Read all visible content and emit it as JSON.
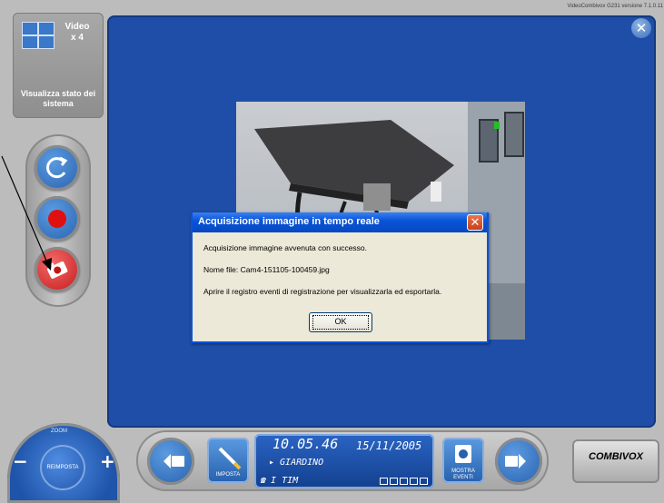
{
  "app": {
    "version_text": "VideoCombivox G231 versione 7.1.0.11"
  },
  "sidebar": {
    "video_label": "Video",
    "video_count": "x 4",
    "status_label": "Visualizza stato dei sistema"
  },
  "dialog": {
    "title": "Acquisizione immagine in tempo reale",
    "message": "Acquisizione immagine avvenuta con successo.",
    "filename": "Nome file: Cam4-151105-100459.jpg",
    "hint": "Aprire il registro eventi di registrazione per visualizzarla ed esportarla.",
    "ok_label": "OK"
  },
  "zoom": {
    "label": "ZOOM",
    "reset_label": "REIMPOSTA",
    "minus": "−",
    "plus": "+"
  },
  "toolbar": {
    "imposta_label": "IMPOSTA",
    "eventi_label": "MOSTRA EVENTI",
    "time": "10.05.46",
    "date": "15/11/2005",
    "location": "▸ GIARDINO",
    "operator": "☎ I TIM"
  },
  "brand": {
    "logo_text": "COMBIVOX"
  },
  "colors": {
    "screen_blue": "#1e4ea8",
    "dialog_title_blue": "#0a55d8",
    "record_red": "#e01010"
  }
}
